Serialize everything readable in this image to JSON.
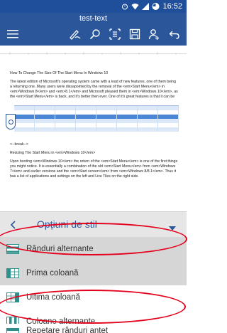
{
  "status_bar": {
    "time": "16:52",
    "icons": [
      "alarm-icon",
      "wifi-icon",
      "signal-icon",
      "battery-icon"
    ]
  },
  "header": {
    "title": "test-text",
    "toolbar_icons": [
      "menu-icon",
      "draw-icon",
      "search-icon",
      "reading-view-icon",
      "save-icon",
      "share-icon",
      "undo-icon"
    ]
  },
  "document": {
    "heading": "How To Change The Size Of The Start Menu In Windows 10",
    "paragraph1": "The latest edition of Microsoft's operating system came with a load of new features, one of them being a returning one. Many users were dissapointed by the removal of the <em>Start Menu</em> in <em>Windows 8</em> and <em>8.1</em> and Microsoft pleased them in <em>Windows 10</em>, as the <em>Start Menu</em> is back, and it's better then ever. One of it's great features is that it can be",
    "break_marker": "<--break-->",
    "subheading": "Resizing The Start Menu in <em>Windows 10</em>",
    "paragraph2": "Upon booting <em>Windows 10</em> the return of the <em>Start Menu</em> is one of the first things you might notice. It is essentially a combination of the old <em>Start Menu</em> from <em>Windows 7</em> and earlier versions and the <em>Start screen</em> from <em>Windows 8/8.1</em>. Thus it has a list of applications and settings on the left and Live Tiles on the right side."
  },
  "options_panel": {
    "title": "Opțiuni de stil",
    "items": [
      {
        "label": "Rânduri alternante",
        "selected": true,
        "icon": "banded-rows-icon"
      },
      {
        "label": "Prima coloană",
        "selected": true,
        "icon": "first-column-icon"
      },
      {
        "label": "Ultima coloană",
        "selected": false,
        "icon": "last-column-icon"
      },
      {
        "label": "Coloane alternante",
        "selected": false,
        "icon": "banded-columns-icon"
      },
      {
        "label": "Repetare rânduri antet",
        "selected": false,
        "icon": "repeat-header-rows-icon"
      }
    ]
  },
  "colors": {
    "status_bar": "#1f4e9a",
    "header": "#2b579a",
    "accent": "#2b579a",
    "highlight": "#e4001c",
    "selected_row": "#d6d6d6"
  }
}
